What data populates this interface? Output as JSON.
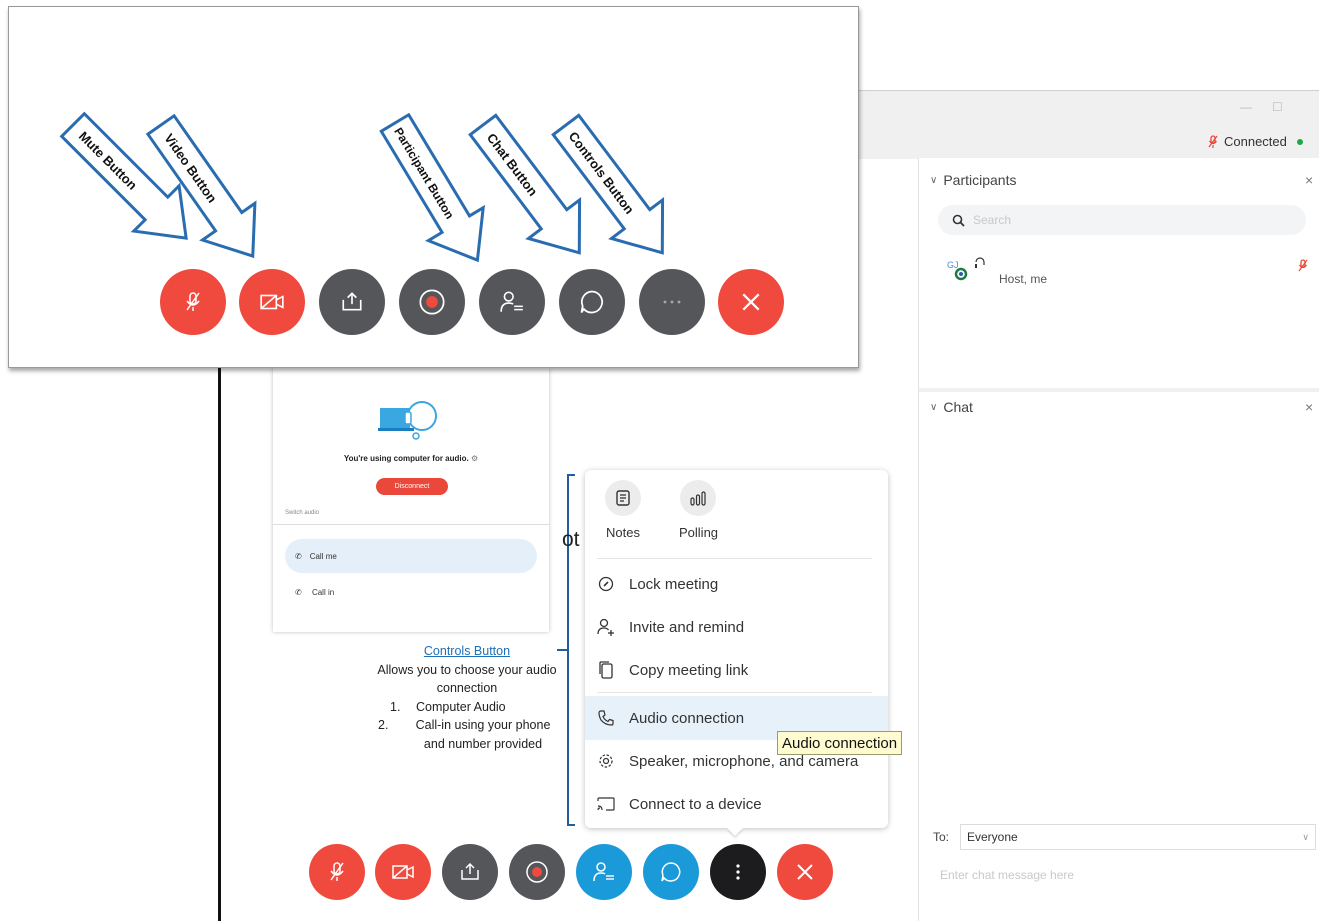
{
  "window": {
    "status": "Connected",
    "minimize_glyph": "—",
    "restore_glyph": "☐"
  },
  "participants": {
    "header": "Participants",
    "close_glyph": "×",
    "search_placeholder": "Search",
    "list": [
      {
        "initials": "GJ",
        "name": "Host, me"
      }
    ]
  },
  "chat": {
    "header": "Chat",
    "close_glyph": "×",
    "to_label": "To:",
    "to_value": "Everyone",
    "input_placeholder": "Enter chat message here"
  },
  "audio_card": {
    "message": "You're using computer for audio.",
    "disconnect_label": "Disconnect",
    "switch_label": "Switch audio",
    "options": [
      "Call me",
      "Call in"
    ]
  },
  "caption": {
    "title": "Controls Button",
    "line1": "Allows you to choose your audio connection",
    "items": [
      "Computer Audio",
      "Call-in using your phone and number provided"
    ],
    "partial_word": "ot"
  },
  "controls_menu": {
    "tiles": [
      {
        "label": "Notes",
        "icon": "notes-icon"
      },
      {
        "label": "Polling",
        "icon": "polling-icon"
      }
    ],
    "items": [
      {
        "label": "Lock meeting",
        "icon": "lock-icon"
      },
      {
        "label": "Invite and remind",
        "icon": "invite-icon"
      },
      {
        "label": "Copy meeting link",
        "icon": "copy-icon"
      },
      {
        "label": "Audio connection",
        "icon": "phone-icon"
      },
      {
        "label": "Speaker, microphone, and camera",
        "icon": "gear-icon"
      },
      {
        "label": "Connect to a device",
        "icon": "cast-icon"
      }
    ],
    "tooltip": "Audio connection",
    "highlighted_item": "Audio connection"
  },
  "callouts": {
    "arrows": [
      "Mute Button",
      "Video Button",
      "Participant Button",
      "Chat Button",
      "Controls Button"
    ]
  },
  "colors": {
    "red": "#f04a3e",
    "grey": "#555659",
    "blue": "#1a9ad9",
    "black": "#1c1c1e",
    "arrow_outline": "#2a6cb0",
    "link_blue": "#1f6fb5"
  }
}
